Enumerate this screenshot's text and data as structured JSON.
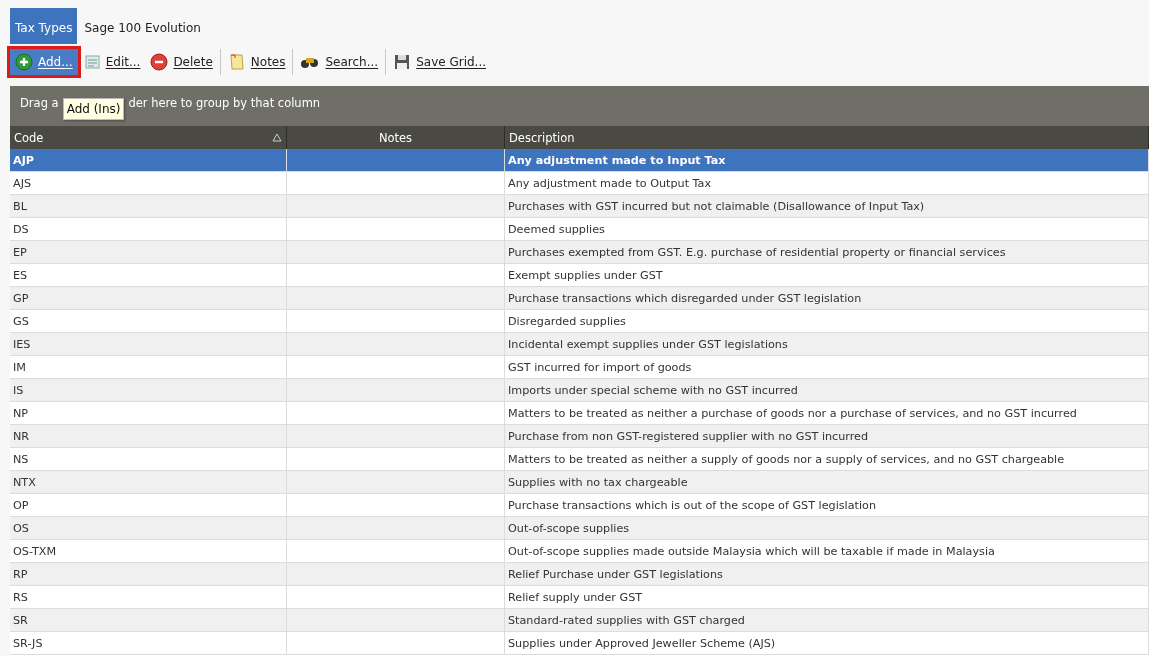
{
  "tabs": [
    {
      "label": "Tax Types",
      "selected": true
    },
    {
      "label": "Sage 100 Evolution",
      "selected": false
    }
  ],
  "toolbar": [
    {
      "kind": "add",
      "label": "Add...",
      "highlighted": true
    },
    {
      "kind": "edit",
      "label": "Edit...",
      "highlighted": false
    },
    {
      "kind": "delete",
      "label": "Delete",
      "highlighted": false
    },
    {
      "kind": "notes",
      "label": "Notes",
      "highlighted": false
    },
    {
      "kind": "search",
      "label": "Search...",
      "highlighted": false
    },
    {
      "kind": "save",
      "label": "Save Grid...",
      "highlighted": false
    }
  ],
  "tooltip": "Add (Ins)",
  "group_panel": {
    "text_before": "Drag a",
    "text_after": "der here to group by that column"
  },
  "table": {
    "columns": [
      "Code",
      "Notes",
      "Description"
    ],
    "rows": [
      {
        "code": "AJP",
        "description": "Any adjustment made to Input Tax",
        "selected": true
      },
      {
        "code": "AJS",
        "description": "Any adjustment made to Output Tax",
        "selected": false
      },
      {
        "code": "BL",
        "description": "Purchases with GST incurred but not claimable (Disallowance of Input Tax)",
        "selected": false
      },
      {
        "code": "DS",
        "description": "Deemed supplies",
        "selected": false
      },
      {
        "code": "EP",
        "description": "Purchases exempted from GST. E.g. purchase of residential property or financial services",
        "selected": false
      },
      {
        "code": "ES",
        "description": "Exempt supplies under GST",
        "selected": false
      },
      {
        "code": "GP",
        "description": "Purchase transactions which disregarded under GST legislation",
        "selected": false
      },
      {
        "code": "GS",
        "description": "Disregarded supplies",
        "selected": false
      },
      {
        "code": "IES",
        "description": "Incidental exempt supplies under GST legislations",
        "selected": false
      },
      {
        "code": "IM",
        "description": "GST incurred for import of goods",
        "selected": false
      },
      {
        "code": "IS",
        "description": "Imports under special scheme with no GST incurred",
        "selected": false
      },
      {
        "code": "NP",
        "description": "Matters to be treated as neither a purchase of goods nor a purchase of services, and no GST incurred",
        "selected": false
      },
      {
        "code": "NR",
        "description": "Purchase from non GST-registered supplier with no GST incurred",
        "selected": false
      },
      {
        "code": "NS",
        "description": "Matters to be treated as neither a supply of goods nor a supply of services, and no GST chargeable",
        "selected": false
      },
      {
        "code": "NTX",
        "description": "Supplies with no tax chargeable",
        "selected": false
      },
      {
        "code": "OP",
        "description": "Purchase transactions which is out of the scope of GST legislation",
        "selected": false
      },
      {
        "code": "OS",
        "description": "Out-of-scope supplies",
        "selected": false
      },
      {
        "code": "OS-TXM",
        "description": "Out-of-scope supplies made outside Malaysia which will be taxable if made in Malaysia",
        "selected": false
      },
      {
        "code": "RP",
        "description": "Relief Purchase under GST legislations",
        "selected": false
      },
      {
        "code": "RS",
        "description": "Relief supply under GST",
        "selected": false
      },
      {
        "code": "SR",
        "description": "Standard-rated supplies with GST charged",
        "selected": false
      },
      {
        "code": "SR-JS",
        "description": "Supplies under Approved Jeweller Scheme (AJS)",
        "selected": false
      }
    ]
  }
}
